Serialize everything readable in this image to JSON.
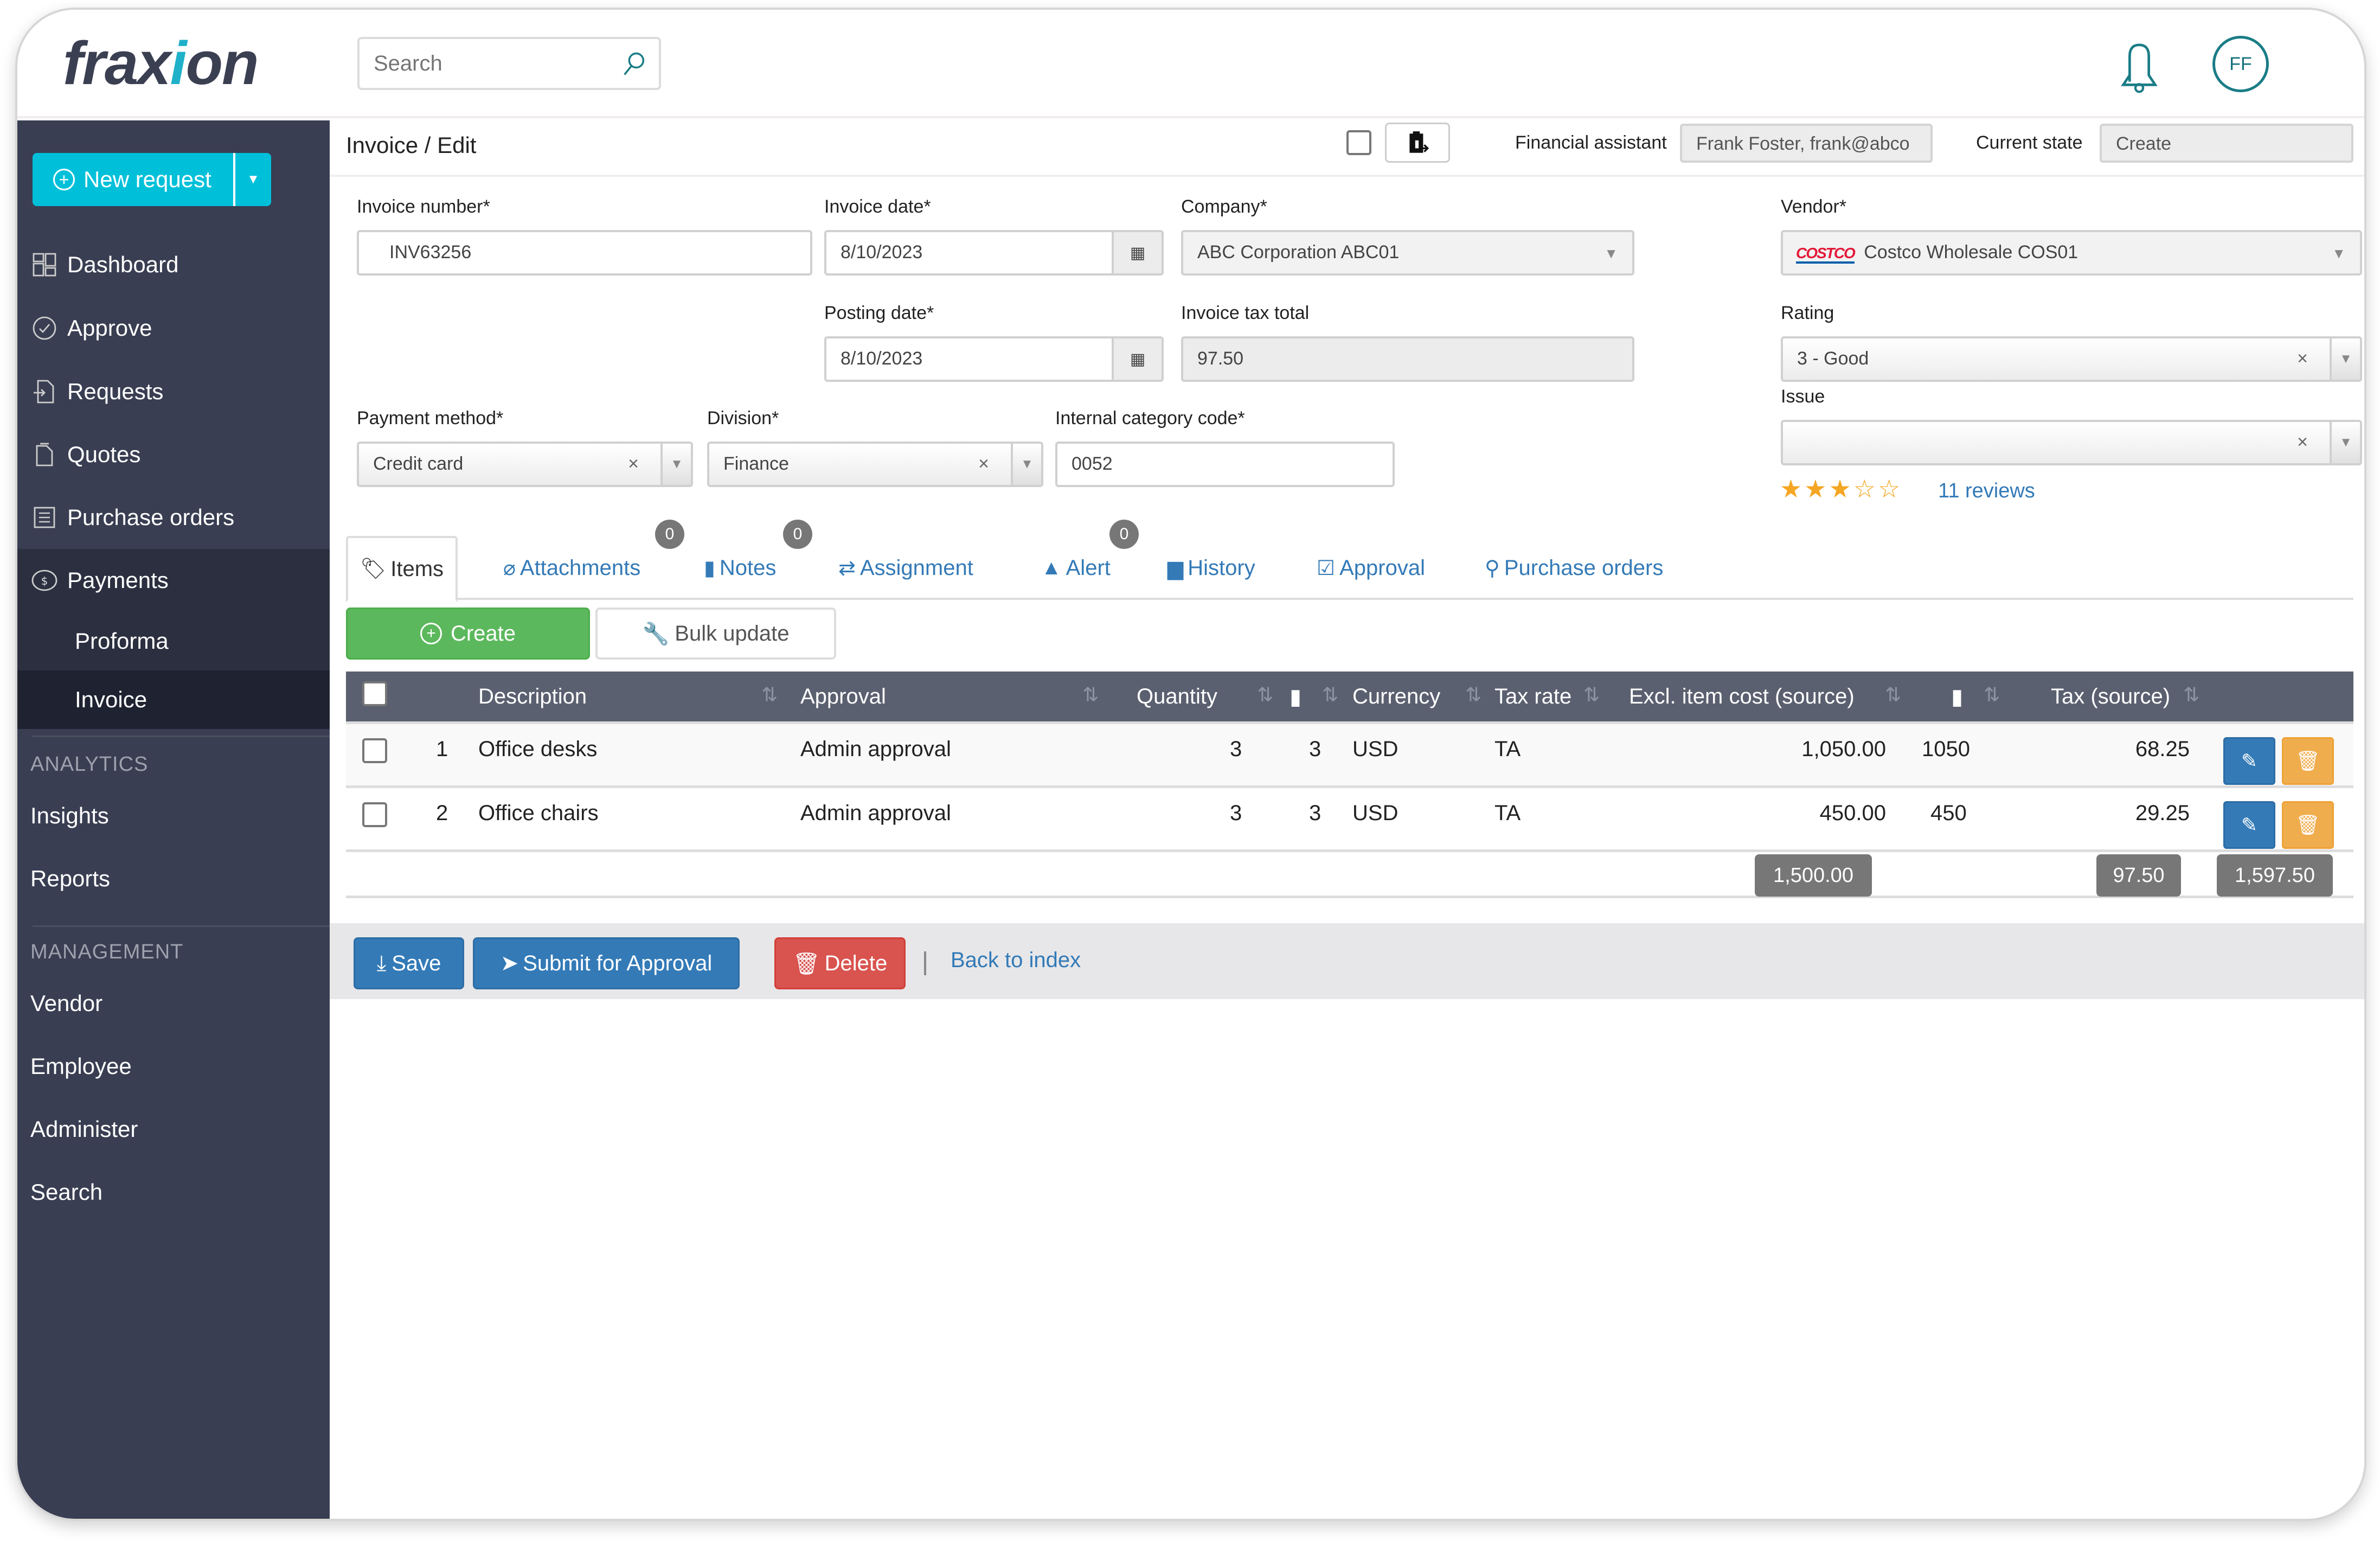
{
  "app": {
    "brand": "fraxion",
    "brand_dot": "o"
  },
  "header": {
    "search_placeholder": "Search",
    "user_initials": "FF"
  },
  "sidebar": {
    "new_request_label": "New request",
    "items": [
      {
        "label": "Dashboard",
        "icon": "dashboard-icon"
      },
      {
        "label": "Approve",
        "icon": "check-circle-icon"
      },
      {
        "label": "Requests",
        "icon": "requests-icon"
      },
      {
        "label": "Quotes",
        "icon": "quotes-icon"
      },
      {
        "label": "Purchase orders",
        "icon": "list-icon"
      },
      {
        "label": "Payments",
        "icon": "dollar-circle-icon"
      }
    ],
    "payments_sub": [
      {
        "label": "Proforma"
      },
      {
        "label": "Invoice"
      }
    ],
    "analytics_heading": "ANALYTICS",
    "analytics": [
      {
        "label": "Insights"
      },
      {
        "label": "Reports"
      }
    ],
    "management_heading": "MANAGEMENT",
    "management": [
      {
        "label": "Vendor"
      },
      {
        "label": "Employee"
      },
      {
        "label": "Administer"
      },
      {
        "label": "Search"
      }
    ]
  },
  "page": {
    "breadcrumb": "Invoice / Edit",
    "financial_assistant_label": "Financial assistant",
    "financial_assistant_value": "Frank Foster, frank@abco",
    "current_state_label": "Current state",
    "current_state_value": "Create"
  },
  "form": {
    "invoice_number": {
      "label": "Invoice number*",
      "value": "INV63256"
    },
    "invoice_date": {
      "label": "Invoice date*",
      "value": "8/10/2023"
    },
    "company": {
      "label": "Company*",
      "value": "ABC Corporation ABC01"
    },
    "vendor": {
      "label": "Vendor*",
      "value": "Costco Wholesale COS01",
      "logo_text": "COSTCO"
    },
    "posting_date": {
      "label": "Posting date*",
      "value": "8/10/2023"
    },
    "invoice_tax_total": {
      "label": "Invoice tax total",
      "value": "97.50"
    },
    "rating": {
      "label": "Rating",
      "value": "3 - Good"
    },
    "issue": {
      "label": "Issue",
      "value": ""
    },
    "payment_method": {
      "label": "Payment method*",
      "value": "Credit card"
    },
    "division": {
      "label": "Division*",
      "value": "Finance"
    },
    "internal_category_code": {
      "label": "Internal category code*",
      "value": "0052"
    },
    "stars": {
      "rating": 3,
      "max": 5,
      "filled": "★★★",
      "empty": "☆☆"
    },
    "reviews": "11 reviews"
  },
  "tabs": [
    {
      "label": "Items",
      "icon": "tag-icon",
      "active": true
    },
    {
      "label": "Attachments",
      "icon": "paperclip-icon",
      "badge": "0"
    },
    {
      "label": "Notes",
      "icon": "comment-icon",
      "badge": "0"
    },
    {
      "label": "Assignment",
      "icon": "retweet-icon"
    },
    {
      "label": "Alert",
      "icon": "warning-icon",
      "badge": "0"
    },
    {
      "label": "History",
      "icon": "folder-icon"
    },
    {
      "label": "Approval",
      "icon": "check-square-icon"
    },
    {
      "label": "Purchase orders",
      "icon": "link-icon"
    }
  ],
  "toolbar": {
    "create_label": "Create",
    "bulk_update_label": "Bulk update"
  },
  "table": {
    "columns": [
      "Description",
      "Approval",
      "Quantity",
      "Currency",
      "Tax rate",
      "Excl. item cost (source)",
      "Tax (source)"
    ],
    "rows": [
      {
        "num": "1",
        "description": "Office desks",
        "approval": "Admin approval",
        "quantity": "3",
        "qty2": "3",
        "currency": "USD",
        "tax_rate": "TA",
        "excl_cost": "1,050.00",
        "excl_cost2": "1050",
        "tax": "68.25"
      },
      {
        "num": "2",
        "description": "Office chairs",
        "approval": "Admin approval",
        "quantity": "3",
        "qty2": "3",
        "currency": "USD",
        "tax_rate": "TA",
        "excl_cost": "450.00",
        "excl_cost2": "450",
        "tax": "29.25"
      }
    ],
    "totals": {
      "excl_cost": "1,500.00",
      "tax": "97.50",
      "grand": "1,597.50"
    }
  },
  "footer": {
    "save_label": "Save",
    "submit_label": "Submit for Approval",
    "delete_label": "Delete",
    "back_label": "Back to index"
  }
}
